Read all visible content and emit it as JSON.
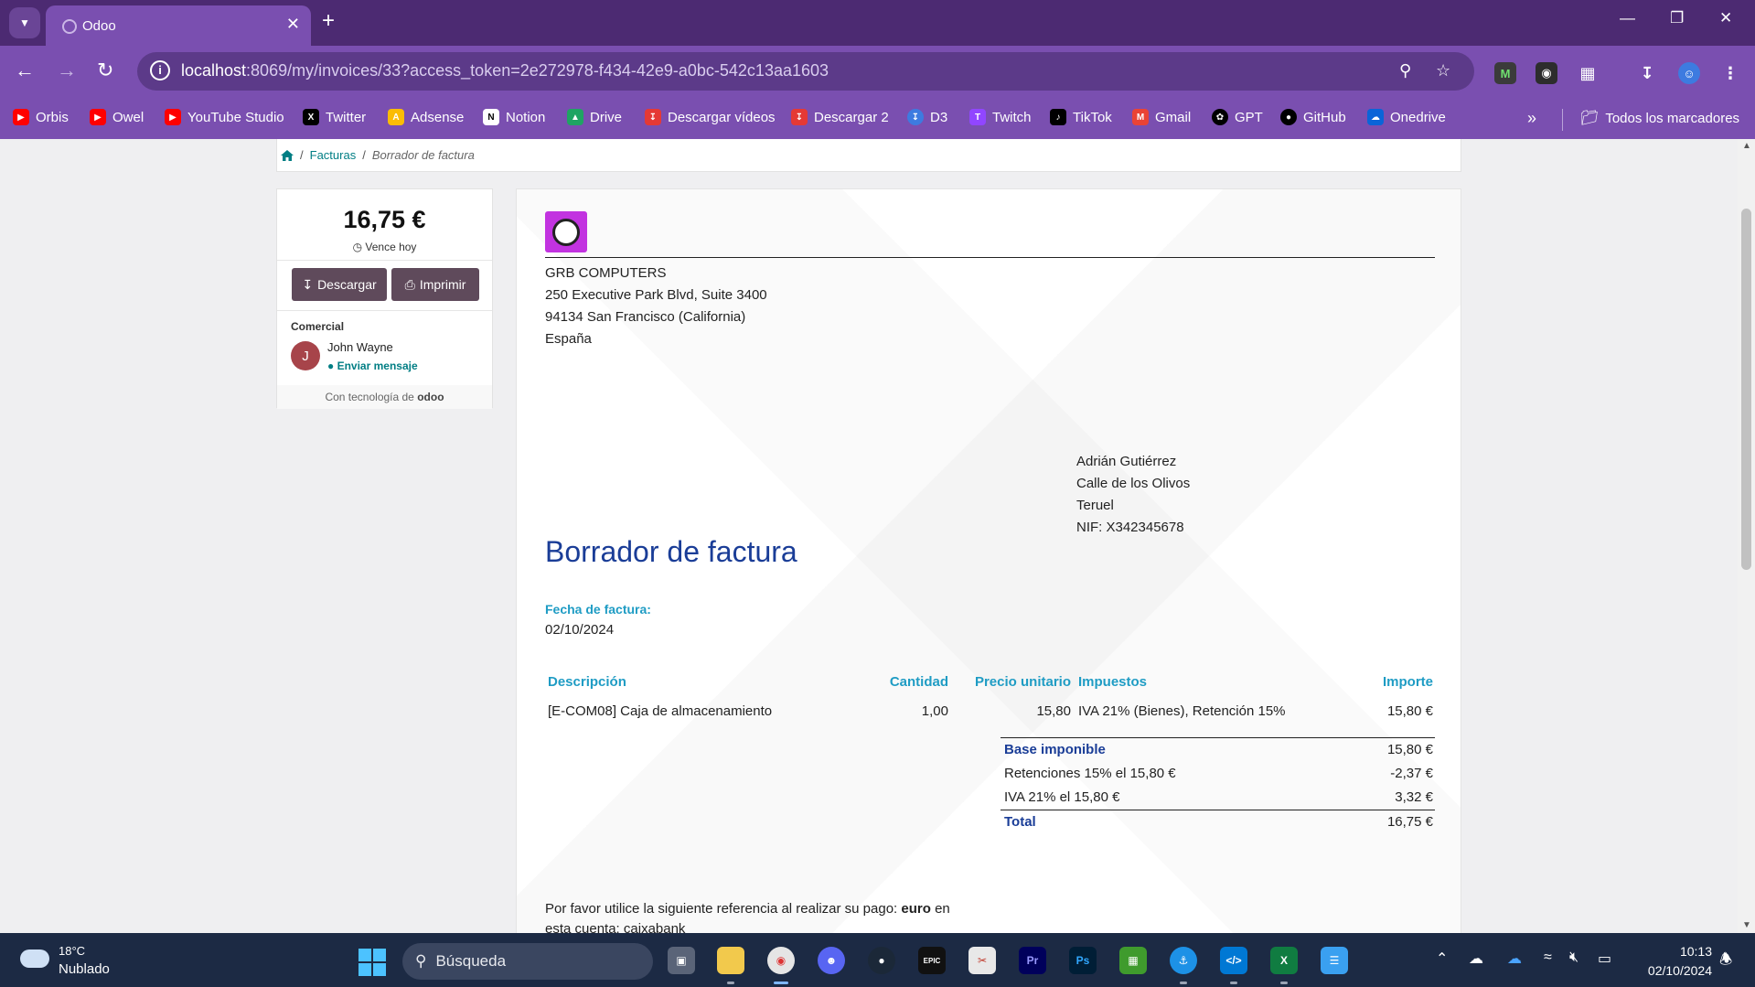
{
  "browser": {
    "tab_title": "Odoo",
    "url_host": "localhost",
    "url_rest": ":8069/my/invoices/33?access_token=2e272978-f434-42e9-a0bc-542c13aa1603",
    "bookmarks": [
      {
        "label": "Orbis",
        "icon": "youtube-icon",
        "color": "#ff0000"
      },
      {
        "label": "Owel",
        "icon": "youtube-icon",
        "color": "#ff0000"
      },
      {
        "label": "YouTube Studio",
        "icon": "youtube-icon",
        "color": "#ff0000"
      },
      {
        "label": "Twitter",
        "icon": "x-icon",
        "color": "#000000"
      },
      {
        "label": "Adsense",
        "icon": "adsense-icon",
        "color": "#fbbc04"
      },
      {
        "label": "Notion",
        "icon": "notion-icon",
        "color": "#ffffff"
      },
      {
        "label": "Drive",
        "icon": "drive-icon",
        "color": "#1fa463"
      },
      {
        "label": "Descargar vídeos",
        "icon": "download-icon",
        "color": "#e53935"
      },
      {
        "label": "Descargar 2",
        "icon": "download-icon",
        "color": "#e53935"
      },
      {
        "label": "D3",
        "icon": "d3-icon",
        "color": "#3d7be0"
      },
      {
        "label": "Twitch",
        "icon": "twitch-icon",
        "color": "#9146ff"
      },
      {
        "label": "TikTok",
        "icon": "tiktok-icon",
        "color": "#000000"
      },
      {
        "label": "Gmail",
        "icon": "gmail-icon",
        "color": "#ea4335"
      },
      {
        "label": "GPT",
        "icon": "openai-icon",
        "color": "#000000"
      },
      {
        "label": "GitHub",
        "icon": "github-icon",
        "color": "#000000"
      },
      {
        "label": "Onedrive",
        "icon": "onedrive-icon",
        "color": "#0a64d8"
      }
    ],
    "all_bookmarks": "Todos los marcadores"
  },
  "breadcrumb": {
    "invoices": "Facturas",
    "current": "Borrador de factura"
  },
  "sidebar": {
    "amount": "16,75 €",
    "due": "Vence hoy",
    "download": "Descargar",
    "print": "Imprimir",
    "salesperson_label": "Comercial",
    "salesperson_initial": "J",
    "salesperson_name": "John Wayne",
    "send_message": "Enviar mensaje",
    "powered_by": "Con tecnología de",
    "odoo": "odoo"
  },
  "company": {
    "name": "GRB COMPUTERS",
    "street": "250 Executive Park Blvd, Suite 3400",
    "city": "94134 San Francisco (California)",
    "country": "España"
  },
  "customer": {
    "name": "Adrián Gutiérrez",
    "street": "Calle de los Olivos",
    "city": "Teruel",
    "vat": "NIF: X342345678"
  },
  "invoice": {
    "title": "Borrador de factura",
    "date_label": "Fecha de factura:",
    "date": "02/10/2024",
    "columns": {
      "description": "Descripción",
      "quantity": "Cantidad",
      "unit_price": "Precio unitario",
      "taxes": "Impuestos",
      "amount": "Importe"
    },
    "line": {
      "description": "[E-COM08] Caja de almacenamiento",
      "quantity": "1,00",
      "unit_price": "15,80",
      "taxes": "IVA 21% (Bienes), Retención 15%",
      "amount": "15,80 €"
    },
    "totals": {
      "base_label": "Base imponible",
      "base_value": "15,80 €",
      "ret_label": "Retenciones 15% el 15,80 €",
      "ret_value": "-2,37 €",
      "iva_label": "IVA 21% el 15,80 €",
      "iva_value": "3,32 €",
      "total_label": "Total",
      "total_value": "16,75 €"
    },
    "payment_ref_text": "Por favor utilice la siguiente referencia al realizar su pago:",
    "payment_ref_strong": "euro",
    "payment_ref_cont": "en esta cuenta: caixabank"
  },
  "taskbar": {
    "temperature": "18°C",
    "weather": "Nublado",
    "search": "Búsqueda",
    "time": "10:13",
    "date": "02/10/2024"
  }
}
